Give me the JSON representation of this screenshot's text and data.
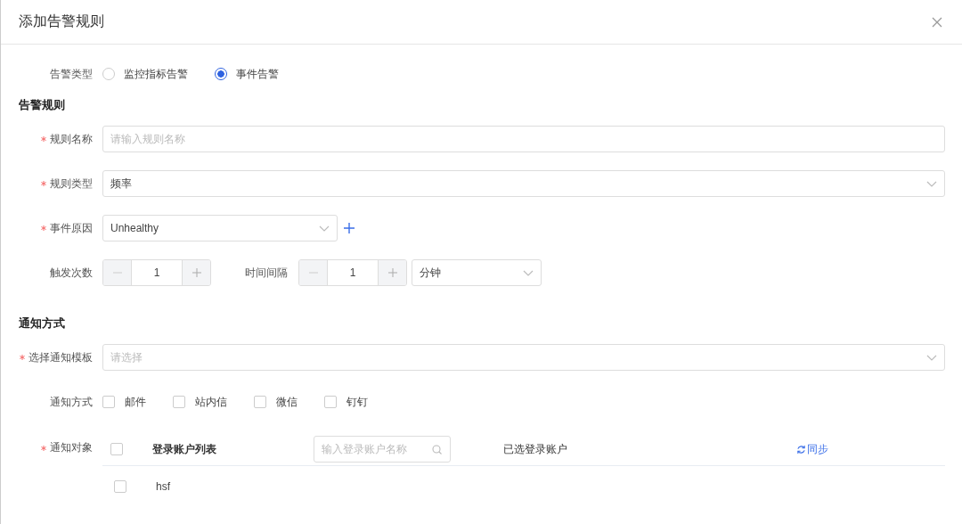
{
  "dialog": {
    "title": "添加告警规则"
  },
  "alert_type": {
    "label": "告警类型",
    "options": [
      {
        "label": "监控指标告警",
        "selected": false
      },
      {
        "label": "事件告警",
        "selected": true
      }
    ]
  },
  "rule_section": {
    "title": "告警规则",
    "name_field": {
      "label": "规则名称",
      "required": true,
      "placeholder": "请输入规则名称"
    },
    "type_field": {
      "label": "规则类型",
      "required": true,
      "value": "频率"
    },
    "reason_field": {
      "label": "事件原因",
      "required": true,
      "value": "Unhealthy"
    },
    "trigger": {
      "label": "触发次数",
      "value": "1"
    },
    "interval": {
      "label": "时间间隔",
      "value": "1",
      "unit": "分钟"
    }
  },
  "notify_section": {
    "title": "通知方式",
    "template_field": {
      "label": "选择通知模板",
      "required": true,
      "placeholder": "请选择"
    },
    "methods": {
      "label": "通知方式",
      "options": [
        {
          "label": "邮件",
          "checked": false
        },
        {
          "label": "站内信",
          "checked": false
        },
        {
          "label": "微信",
          "checked": false
        },
        {
          "label": "钉钉",
          "checked": false
        }
      ]
    },
    "targets": {
      "label": "通知对象",
      "required": true,
      "list_title": "登录账户列表",
      "all_checked": false,
      "search_placeholder": "输入登录账户名称",
      "selected_title": "已选登录账户",
      "sync": "同步",
      "accounts": [
        {
          "name": "hsf",
          "checked": false
        }
      ]
    }
  }
}
